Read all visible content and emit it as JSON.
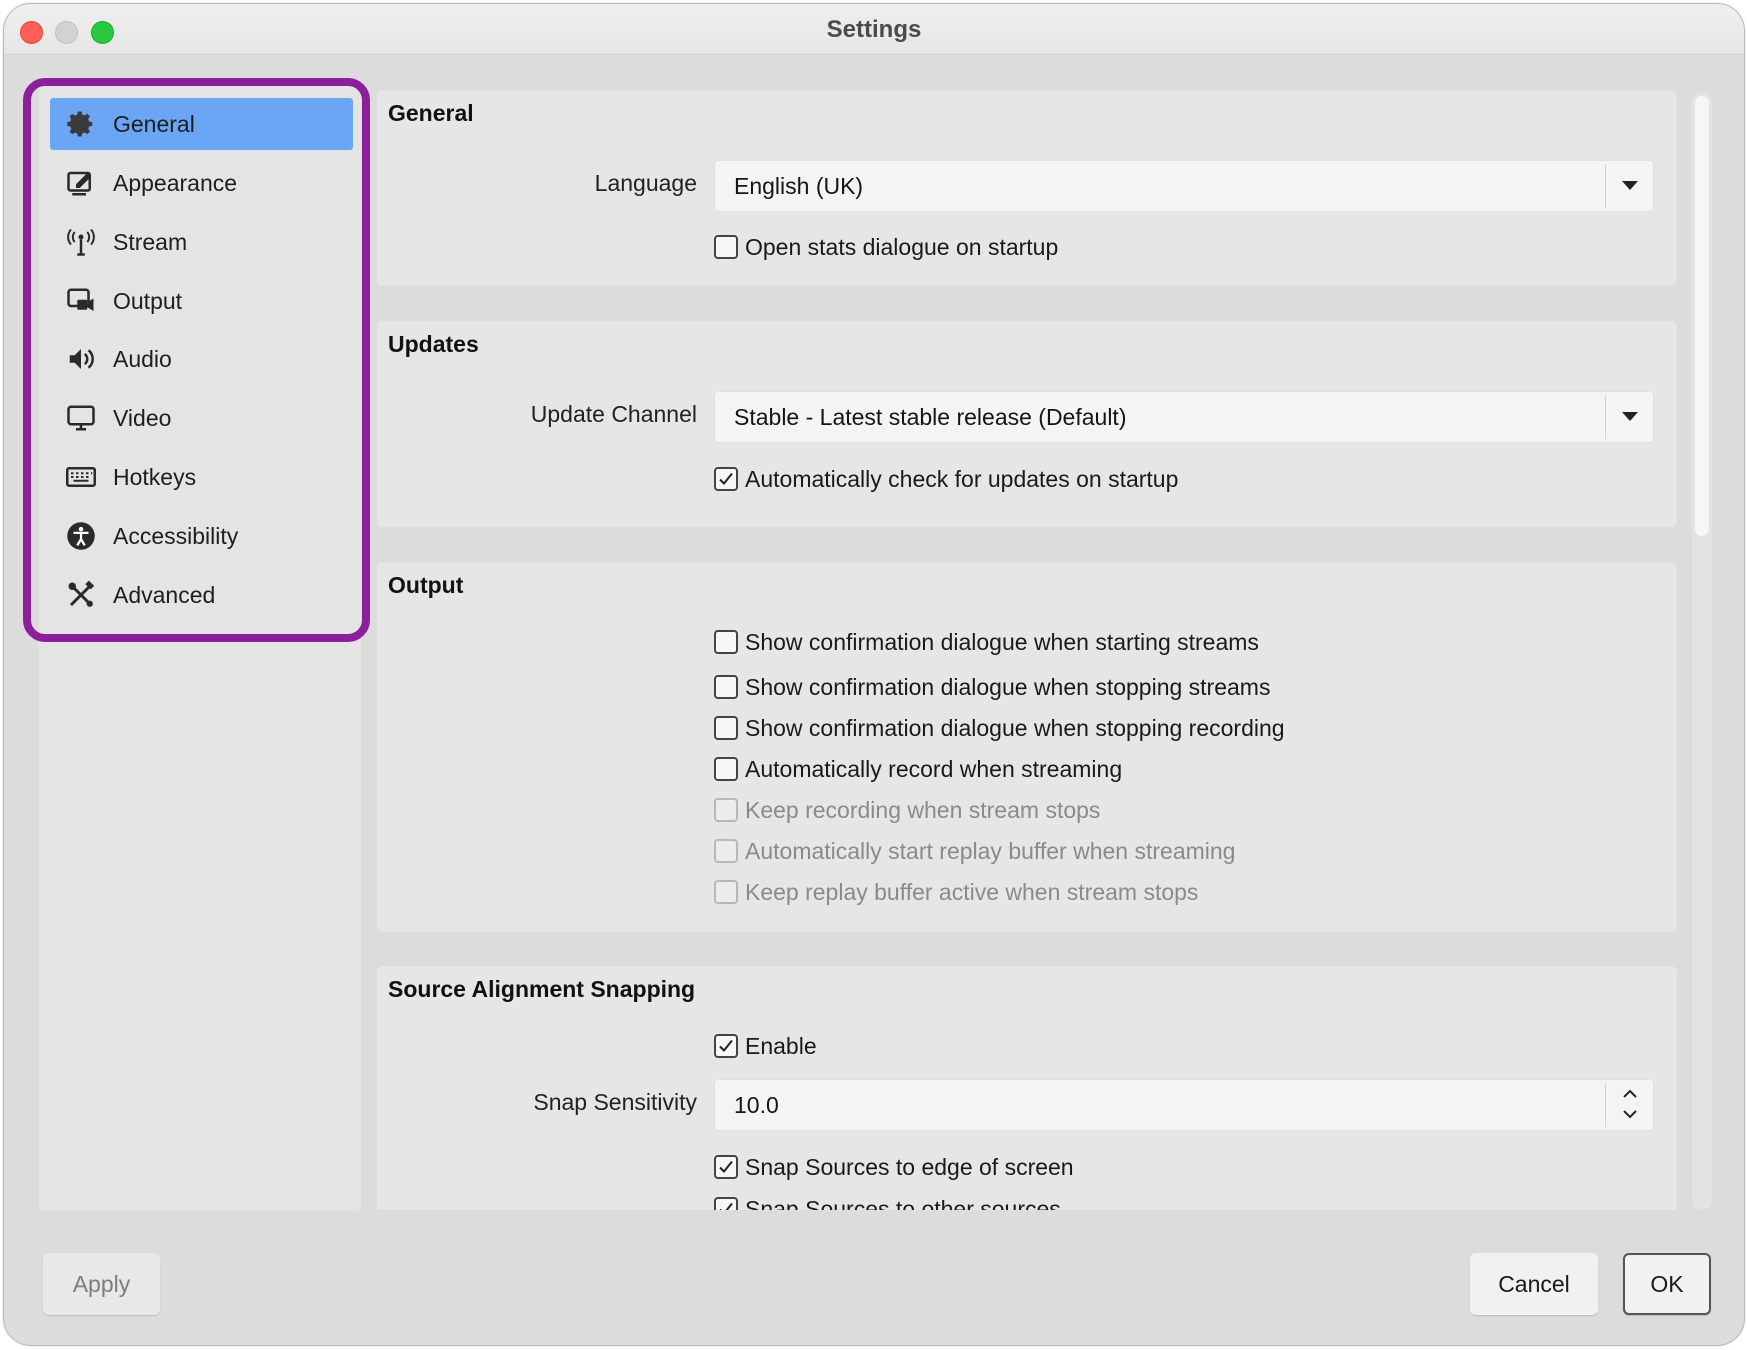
{
  "window": {
    "title": "Settings"
  },
  "sidebar": {
    "items": [
      {
        "label": "General",
        "icon": "gear-icon",
        "active": true
      },
      {
        "label": "Appearance",
        "icon": "appearance-icon"
      },
      {
        "label": "Stream",
        "icon": "antenna-icon"
      },
      {
        "label": "Output",
        "icon": "output-icon"
      },
      {
        "label": "Audio",
        "icon": "speaker-icon"
      },
      {
        "label": "Video",
        "icon": "monitor-icon"
      },
      {
        "label": "Hotkeys",
        "icon": "keyboard-icon"
      },
      {
        "label": "Accessibility",
        "icon": "accessibility-icon"
      },
      {
        "label": "Advanced",
        "icon": "tools-icon"
      }
    ],
    "highlight_color": "#8c1f9a",
    "active_color": "#6aa6f5"
  },
  "general": {
    "title": "General",
    "language_label": "Language",
    "language_value": "English (UK)",
    "open_stats_label": "Open stats dialogue on startup",
    "open_stats_checked": false
  },
  "updates": {
    "title": "Updates",
    "channel_label": "Update Channel",
    "channel_value": "Stable - Latest stable release (Default)",
    "auto_check_label": "Automatically check for updates on startup",
    "auto_check_checked": true
  },
  "output": {
    "title": "Output",
    "options": [
      {
        "label": "Show confirmation dialogue when starting streams",
        "checked": false,
        "disabled": false
      },
      {
        "label": "Show confirmation dialogue when stopping streams",
        "checked": false,
        "disabled": false
      },
      {
        "label": "Show confirmation dialogue when stopping recording",
        "checked": false,
        "disabled": false
      },
      {
        "label": "Automatically record when streaming",
        "checked": false,
        "disabled": false
      },
      {
        "label": "Keep recording when stream stops",
        "checked": false,
        "disabled": true
      },
      {
        "label": "Automatically start replay buffer when streaming",
        "checked": false,
        "disabled": true
      },
      {
        "label": "Keep replay buffer active when stream stops",
        "checked": false,
        "disabled": true
      }
    ]
  },
  "snapping": {
    "title": "Source Alignment Snapping",
    "enable_label": "Enable",
    "enable_checked": true,
    "sensitivity_label": "Snap Sensitivity",
    "sensitivity_value": "10.0",
    "edge_label": "Snap Sources to edge of screen",
    "edge_checked": true,
    "other_label": "Snap Sources to other sources",
    "other_checked": true
  },
  "buttons": {
    "apply": "Apply",
    "cancel": "Cancel",
    "ok": "OK"
  }
}
